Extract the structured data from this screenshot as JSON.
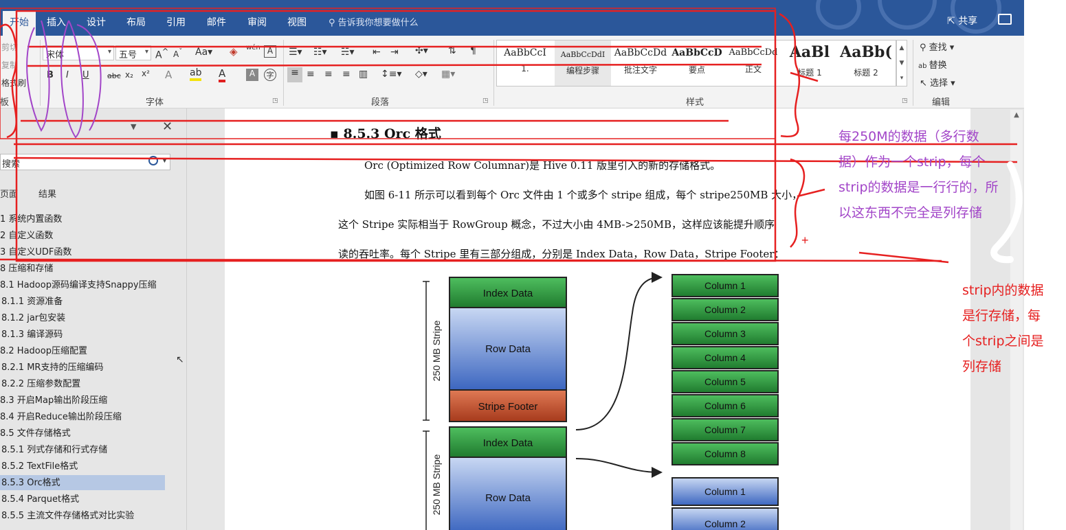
{
  "ribbon": {
    "tabs": [
      "开始",
      "插入",
      "设计",
      "布局",
      "引用",
      "邮件",
      "审阅",
      "视图"
    ],
    "tell_me": "告诉我你想要做什么",
    "share": "共享",
    "clipboard": [
      "剪切",
      "复制",
      "格式刷"
    ],
    "font_name": "宋体",
    "font_size": "五号",
    "groups": {
      "font": "字体",
      "paragraph": "段落",
      "styles": "样式",
      "editing": "编辑"
    },
    "styles": [
      {
        "sample": "AaBbCcI",
        "name": "1."
      },
      {
        "sample": "AaBbCcDdI",
        "name": "编程步骤"
      },
      {
        "sample": "AaBbCcDd",
        "name": "批注文字"
      },
      {
        "sample": "AaBbCcD",
        "name": "要点"
      },
      {
        "sample": "AaBbCcDd",
        "name": "正文"
      },
      {
        "sample": "AaBl",
        "name": "标题 1"
      },
      {
        "sample": "AaBb(",
        "name": "标题 2"
      }
    ],
    "editing": {
      "find": "查找",
      "replace": "替换",
      "select": "选择"
    }
  },
  "nav": {
    "search_placeholder": "搜索",
    "tabs": [
      "页面",
      "结果"
    ],
    "items": [
      "1 系统内置函数",
      "2 自定义函数",
      "3 自定义UDF函数",
      "8 压缩和存储",
      "8.1 Hadoop源码编译支持Snappy压缩",
      "8.1.1 资源准备",
      "8.1.2 jar包安装",
      "8.1.3 编译源码",
      "8.2 Hadoop压缩配置",
      "8.2.1 MR支持的压缩编码",
      "8.2.2 压缩参数配置",
      "8.3 开启Map输出阶段压缩",
      "8.4 开启Reduce输出阶段压缩",
      "8.5 文件存储格式",
      "8.5.1 列式存储和行式存储",
      "8.5.2 TextFile格式",
      "8.5.3 Orc格式",
      "8.5.4 Parquet格式",
      "8.5.5 主流文件存储格式对比实验"
    ]
  },
  "doc": {
    "heading": "8.5.3 Orc 格式",
    "para1": "Orc (Optimized Row Columnar)是 Hive 0.11 版里引入的新的存储格式。",
    "para2_line1": "如图 6-11 所示可以看到每个 Orc 文件由 1 个或多个 stripe 组成，每个 stripe250MB 大小，",
    "para2_line2": "这个 Stripe 实际相当于 RowGroup 概念，不过大小由 4MB->250MB，这样应该能提升顺序",
    "para2_line3": "读的吞吐率。每个 Stripe 里有三部分组成，分别是 Index Data，Row Data，Stripe Footer："
  },
  "diagram": {
    "stripe_label": "250 MB Stripe",
    "index_data": "Index Data",
    "row_data": "Row Data",
    "stripe_footer": "Stripe Footer",
    "columns_green": [
      "Column 1",
      "Column 2",
      "Column 3",
      "Column 4",
      "Column 5",
      "Column 6",
      "Column 7",
      "Column 8"
    ],
    "columns_blue": [
      "Column 1",
      "Column 2"
    ]
  },
  "annotations": {
    "purple_lines": [
      "每250M的数据（多行数",
      "据）作为一个strip，每个",
      "strip的数据是一行行的，所",
      "以这东西不完全是列存储"
    ],
    "red_lines": [
      "strip内的数据",
      "是行存储，每",
      "个strip之间是",
      "列存储"
    ],
    "plus": "+"
  },
  "colors": {
    "ribbon_blue": "#2b579a",
    "annotation_red": "#e62020",
    "annotation_purple": "#a245c8",
    "green_block": "#2f9a3f",
    "blue_block": "#4a78c8",
    "footer_block": "#c0502d"
  }
}
